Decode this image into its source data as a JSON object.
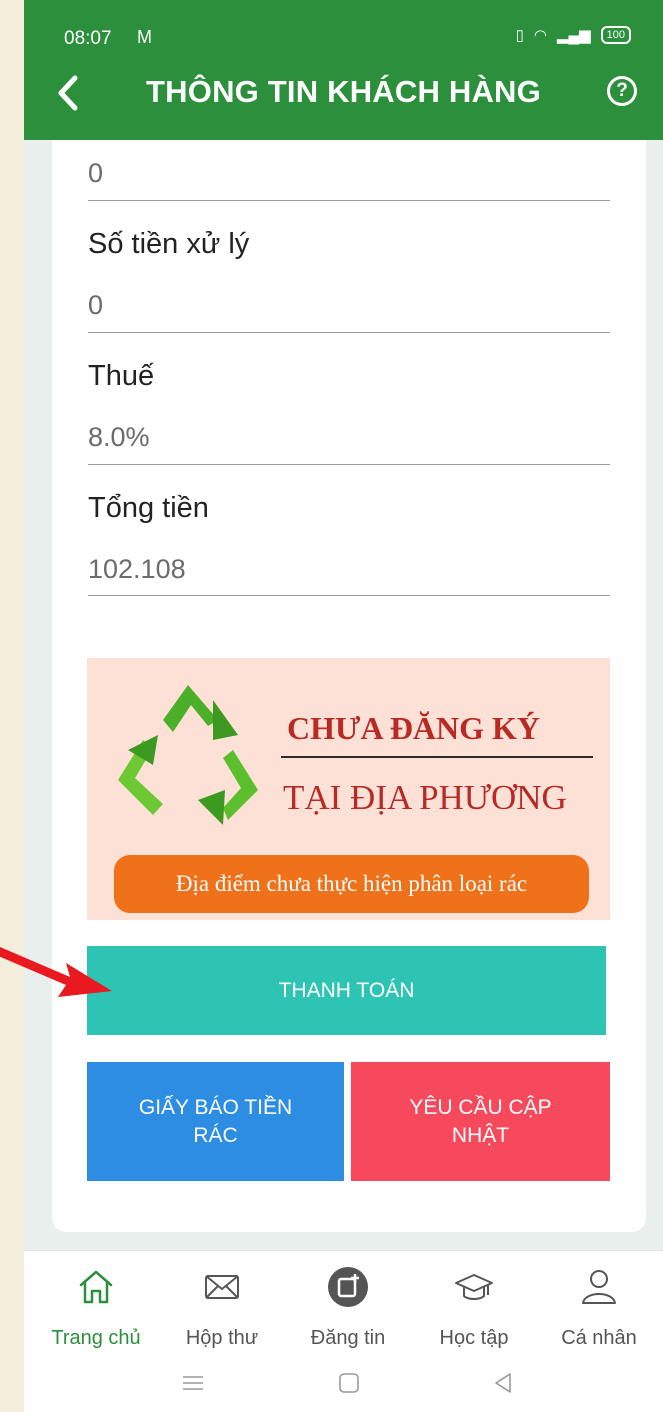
{
  "status": {
    "time": "08:07",
    "battery": "100"
  },
  "header": {
    "title": "THÔNG TIN KHÁCH HÀNG"
  },
  "fields": {
    "prev_value": "0",
    "processing_label": "Số tiền xử lý",
    "processing_value": "0",
    "tax_label": "Thuế",
    "tax_value": "8.0%",
    "total_label": "Tổng tiền",
    "total_value": "102.108"
  },
  "banner": {
    "line1": "CHƯA ĐĂNG KÝ",
    "line2": "TẠI ĐỊA PHƯƠNG",
    "note": "Địa điểm chưa thực hiện phân loại rác"
  },
  "buttons": {
    "pay": "THANH TOÁN",
    "notice": "GIẤY BÁO TIỀN RÁC",
    "update": "YÊU CẦU CẬP NHẬT"
  },
  "nav": {
    "items": [
      {
        "label": "Trang chủ",
        "icon": "home-icon"
      },
      {
        "label": "Hộp thư",
        "icon": "mail-icon"
      },
      {
        "label": "Đăng tin",
        "icon": "post-icon"
      },
      {
        "label": "Học tập",
        "icon": "graduation-cap-icon"
      },
      {
        "label": "Cá nhân",
        "icon": "user-icon"
      }
    ]
  },
  "colors": {
    "header": "#2c8f3c",
    "pay_button": "#2ec4b3",
    "notice_button": "#2d8de3",
    "update_button": "#f64a5c",
    "annotation_arrow": "#e8191f"
  }
}
